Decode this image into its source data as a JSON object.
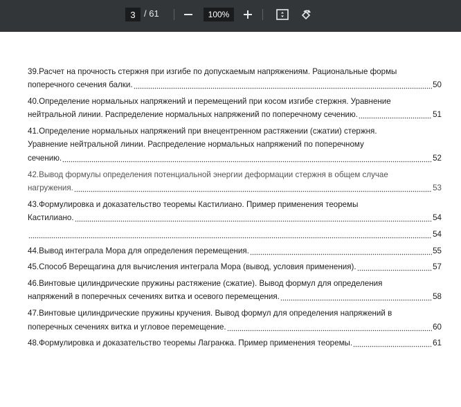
{
  "toolbar": {
    "current_page": "3",
    "total_pages": "/ 61",
    "zoom_level": "100%",
    "icons": [
      "minus-icon",
      "plus-icon",
      "fit-page-icon",
      "rotate-icon"
    ]
  },
  "toc": [
    {
      "lines": [
        "39.Расчет на прочность стержня при изгибе по допускаемым напряжениям. Рациональные формы",
        "поперечного сечения балки."
      ],
      "page": "50"
    },
    {
      "lines": [
        "40.Определение нормальных напряжений и перемещений при косом изгибе стержня. Уравнение",
        "нейтральной линии. Распределение нормальных напряжений по поперечному сечению."
      ],
      "page": "51"
    },
    {
      "lines": [
        "41.Определение нормальных напряжений при внецентренном растяжении (сжатии) стержня.",
        "Уравнение нейтральной линии. Распределение нормальных напряжений по поперечному",
        "сечению."
      ],
      "page": "52"
    },
    {
      "lines": [
        "42.Вывод формулы определения потенциальной энергии деформации стержня в общем случае",
        "нагружения."
      ],
      "page": "53"
    },
    {
      "lines": [
        "43.Формулировка и доказательство теоремы Кастилиано. Пример применения теоремы",
        "Кастилиано."
      ],
      "page": "54"
    },
    {
      "lines": [
        ""
      ],
      "page": "54"
    },
    {
      "lines": [
        "44.Вывод интеграла Мора для определения перемещения."
      ],
      "page": "55"
    },
    {
      "lines": [
        "45.Способ Верещагина для вычисления интеграла Мора (вывод, условия применения)."
      ],
      "page": "57"
    },
    {
      "lines": [
        "46.Винтовые цилиндрические пружины растяжение (сжатие). Вывод формул для определения",
        "напряжений в поперечных сечениях витка и осевого перемещения."
      ],
      "page": "58"
    },
    {
      "lines": [
        "47.Винтовые цилиндрические пружины кручения. Вывод формул для определения напряжений в",
        "поперечных сечениях витка и угловое перемещение."
      ],
      "page": "60"
    },
    {
      "lines": [
        "48.Формулировка и доказательство теоремы Лагранжа. Пример применения теоремы."
      ],
      "page": "61"
    }
  ]
}
